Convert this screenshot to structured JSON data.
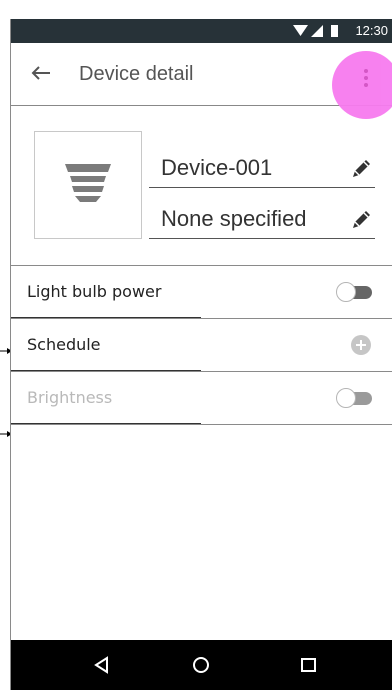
{
  "status_bar": {
    "time": "12:30",
    "icons": [
      "wifi-icon",
      "signal-icon",
      "battery-icon"
    ]
  },
  "app_bar": {
    "title": "Device detail",
    "back_icon": "arrow-left-icon",
    "menu_icon": "vertical-ellipsis-icon",
    "highlight_color": "#f77bef"
  },
  "device": {
    "image_icon": "light-bulb-icon",
    "name": "Device-001",
    "description": "None specified",
    "edit_icon": "pencil-icon"
  },
  "settings": [
    {
      "label": "Light bulb power",
      "control": "toggle",
      "enabled": true
    },
    {
      "label": "Schedule",
      "control": "add-icon",
      "enabled": true
    },
    {
      "label": "Brightness",
      "control": "toggle",
      "enabled": false
    }
  ],
  "nav_bar": {
    "icons": [
      "triangle-back-icon",
      "circle-home-icon",
      "square-recent-icon"
    ]
  },
  "colors": {
    "status_bar": "#273238",
    "menu_highlight": "#f77bef",
    "disabled_text": "#b9b9b9"
  }
}
